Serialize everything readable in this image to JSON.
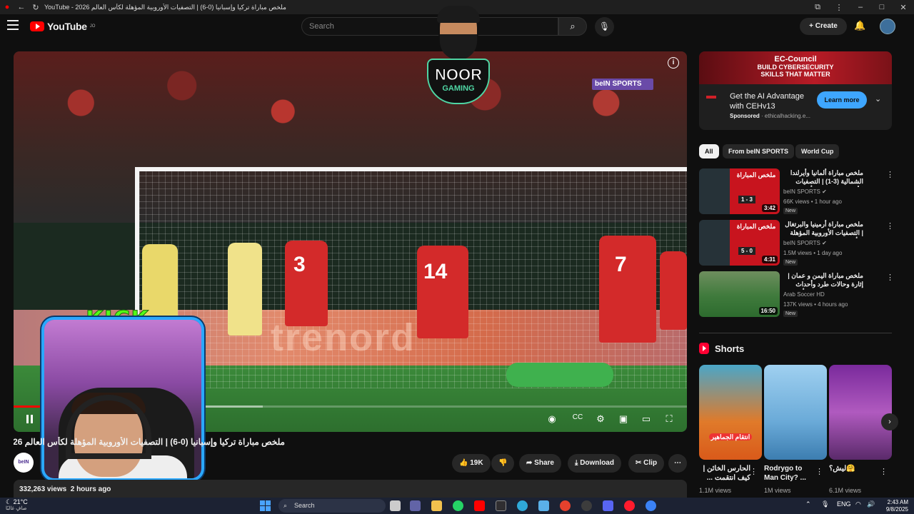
{
  "browser": {
    "tab_title": "YouTube - ملخص مباراة تركيا وإسبانيا (0-6) | التصفيات الأوروبية المؤهلة لكأس العالم 2026"
  },
  "header": {
    "logo_text": "YouTube",
    "logo_region": "JO",
    "search_placeholder": "Search",
    "create_label": "Create"
  },
  "overlay": {
    "streamer_name": "NOOR",
    "streamer_sub": "GAMING",
    "kick_label": "KICK",
    "broadcaster": "beIN SPORTS",
    "ad_board_text": "trenord"
  },
  "player": {
    "progress_played": 0.28,
    "progress_buffered": 0.37,
    "jersey_numbers": [
      "3",
      "14",
      "7"
    ]
  },
  "video": {
    "title": "ملخص مباراة تركيا وإسبانيا (0-6) | التصفيات الأوروبية المؤهلة لكأس العالم 2026",
    "title_visible_end": "م 2026",
    "channel_avatar_text": "beIN",
    "likes": "19K",
    "share_label": "Share",
    "download_label": "Download",
    "clip_label": "Clip",
    "views": "332,263 views",
    "posted": "2 hours ago"
  },
  "ad": {
    "banner_line1": "EC-Council",
    "banner_line2": "BUILD CYBERSECURITY",
    "banner_line3": "SKILLS THAT MATTER",
    "headline": "Get the AI Advantage with CEHv13",
    "sponsored": "Sponsored",
    "domain": "ethicalhacking.e...",
    "cta": "Learn more"
  },
  "chips": [
    "All",
    "From beIN SPORTS",
    "World Cup"
  ],
  "related": [
    {
      "title": "ملخص مباراة ألمانيا وأيرلندا الشمالية (3-1) | التصفيات الأوروبية المؤهلة لكأس العالم ...",
      "thumb_label": "ملخص المباراة",
      "thumb_score": "1 - 3",
      "channel": "beIN SPORTS",
      "views": "66K views",
      "age": "1 hour ago",
      "badge": "New",
      "duration": "3:42"
    },
    {
      "title": "ملخص مباراة أرمينيا والبرتغال | التصفيات الأوروبية المؤهلة لكأس العالم 2026",
      "thumb_label": "ملخص المباراة",
      "thumb_score": "5 - 0",
      "channel": "beIN SPORTS",
      "views": "1.5M views",
      "age": "1 day ago",
      "badge": "New",
      "duration": "4:31"
    },
    {
      "title": "ملخص مباراة اليمن و عمان | إثارة وحالات طرد وأحداث مؤسفة | نصف نهائي كأس ...",
      "channel": "Arab Soccer HD",
      "views": "137K views",
      "age": "4 hours ago",
      "badge": "New",
      "duration": "16:50"
    }
  ],
  "shorts": {
    "heading": "Shorts",
    "items": [
      {
        "caption": "انتقام الجماهير",
        "title": "الحارس الخائن | كيف انتقمت ...",
        "views": "1.1M views"
      },
      {
        "title": "Rodrygo to Man City? ...",
        "views": "1M views"
      },
      {
        "title": "ليش؟🤗",
        "views": "6.1M views"
      }
    ]
  },
  "taskbar": {
    "temperature": "21°C",
    "weather_desc": "صافٍ غالبًا",
    "search_label": "Search",
    "language": "ENG",
    "time": "2:43 AM",
    "date": "9/8/2025"
  },
  "colors": {
    "accent_red": "#ff0000",
    "kick_green": "#53fc18",
    "learn_blue": "#3ea6ff"
  }
}
